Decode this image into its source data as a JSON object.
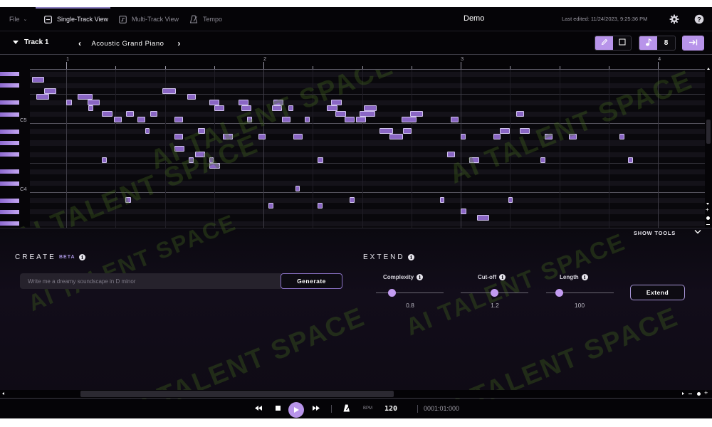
{
  "topnav": {
    "file_menu": "File",
    "tabs": [
      {
        "label": "Single-Track View",
        "active": true
      },
      {
        "label": "Multi-Track View",
        "active": false
      },
      {
        "label": "Tempo",
        "active": false
      }
    ],
    "doc_title": "Demo",
    "last_edited": "Last edited: 11/24/2023, 9:25:36 PM"
  },
  "track": {
    "name": "Track 1",
    "instrument": "Acoustic Grand Piano",
    "draw_tool_active": true,
    "select_tool_active": false,
    "note_length_value": "8"
  },
  "ruler": {
    "bars": [
      "1",
      "2",
      "3",
      "4"
    ]
  },
  "piano_roll": {
    "key_labels": [
      {
        "label": "C5",
        "pitch": 72
      },
      {
        "label": "C4",
        "pitch": 60
      }
    ],
    "top_pitch": 80,
    "beats_per_bar": 4,
    "notes": [
      {
        "pitch": 79,
        "start": -0.7,
        "dur": 0.25
      },
      {
        "pitch": 77,
        "start": -0.45,
        "dur": 0.25
      },
      {
        "pitch": 76,
        "start": -0.6,
        "dur": 0.25
      },
      {
        "pitch": 76,
        "start": 0.23,
        "dur": 0.3
      },
      {
        "pitch": 75,
        "start": 0.0,
        "dur": 0.12
      },
      {
        "pitch": 75,
        "start": 0.43,
        "dur": 0.25
      },
      {
        "pitch": 73,
        "start": 0.72,
        "dur": 0.22
      },
      {
        "pitch": 72,
        "start": 0.97,
        "dur": 0.15
      },
      {
        "pitch": 73,
        "start": 1.22,
        "dur": 0.15
      },
      {
        "pitch": 72,
        "start": 1.45,
        "dur": 0.15
      },
      {
        "pitch": 73,
        "start": 1.7,
        "dur": 0.15
      },
      {
        "pitch": 70,
        "start": 1.6,
        "dur": 0.06
      },
      {
        "pitch": 77,
        "start": 1.95,
        "dur": 0.27
      },
      {
        "pitch": 76,
        "start": 2.45,
        "dur": 0.18
      },
      {
        "pitch": 75,
        "start": 2.9,
        "dur": 0.2
      },
      {
        "pitch": 75,
        "start": 3.5,
        "dur": 0.2
      },
      {
        "pitch": 75,
        "start": 4.2,
        "dur": 0.2
      },
      {
        "pitch": 75,
        "start": 5.37,
        "dur": 0.22
      },
      {
        "pitch": 72,
        "start": 2.2,
        "dur": 0.17
      },
      {
        "pitch": 72,
        "start": 3.67,
        "dur": 0.1
      },
      {
        "pitch": 72,
        "start": 4.38,
        "dur": 0.17
      },
      {
        "pitch": 72,
        "start": 4.84,
        "dur": 0.1
      },
      {
        "pitch": 72,
        "start": 5.65,
        "dur": 0.2
      },
      {
        "pitch": 72,
        "start": 5.88,
        "dur": 0.2
      },
      {
        "pitch": 72,
        "start": 6.8,
        "dur": 0.3
      },
      {
        "pitch": 72,
        "start": 7.8,
        "dur": 0.15
      },
      {
        "pitch": 73,
        "start": 5.46,
        "dur": 0.22
      },
      {
        "pitch": 73,
        "start": 5.95,
        "dur": 0.32
      },
      {
        "pitch": 73,
        "start": 6.97,
        "dur": 0.27
      },
      {
        "pitch": 70,
        "start": 2.67,
        "dur": 0.15
      },
      {
        "pitch": 70,
        "start": 6.36,
        "dur": 0.27
      },
      {
        "pitch": 70,
        "start": 6.83,
        "dur": 0.17
      },
      {
        "pitch": 69,
        "start": 2.2,
        "dur": 0.17
      },
      {
        "pitch": 69,
        "start": 3.18,
        "dur": 0.2
      },
      {
        "pitch": 69,
        "start": 3.9,
        "dur": 0.15
      },
      {
        "pitch": 69,
        "start": 4.6,
        "dur": 0.2
      },
      {
        "pitch": 69,
        "start": 6.56,
        "dur": 0.27
      },
      {
        "pitch": 69,
        "start": 8.0,
        "dur": 0.1
      },
      {
        "pitch": 69,
        "start": 8.66,
        "dur": 0.15
      },
      {
        "pitch": 69,
        "start": 9.7,
        "dur": 0.17
      },
      {
        "pitch": 69,
        "start": 10.2,
        "dur": 0.15
      },
      {
        "pitch": 69,
        "start": 11.22,
        "dur": 0.1
      },
      {
        "pitch": 70,
        "start": 8.8,
        "dur": 0.2
      },
      {
        "pitch": 70,
        "start": 9.2,
        "dur": 0.2
      },
      {
        "pitch": 73,
        "start": 9.12,
        "dur": 0.17
      },
      {
        "pitch": 67,
        "start": 2.2,
        "dur": 0.2
      },
      {
        "pitch": 66,
        "start": 2.62,
        "dur": 0.2
      },
      {
        "pitch": 66,
        "start": 7.72,
        "dur": 0.17
      },
      {
        "pitch": 65,
        "start": 0.72,
        "dur": 0.1
      },
      {
        "pitch": 65,
        "start": 2.48,
        "dur": 0.1
      },
      {
        "pitch": 65,
        "start": 2.9,
        "dur": 0.06
      },
      {
        "pitch": 65,
        "start": 5.1,
        "dur": 0.12
      },
      {
        "pitch": 65,
        "start": 8.17,
        "dur": 0.2
      },
      {
        "pitch": 65,
        "start": 9.62,
        "dur": 0.1
      },
      {
        "pitch": 65,
        "start": 11.4,
        "dur": 0.1
      },
      {
        "pitch": 64,
        "start": 2.9,
        "dur": 0.22
      },
      {
        "pitch": 60,
        "start": 4.65,
        "dur": 0.08
      },
      {
        "pitch": 58,
        "start": 1.2,
        "dur": 0.12
      },
      {
        "pitch": 58,
        "start": 5.75,
        "dur": 0.1
      },
      {
        "pitch": 58,
        "start": 7.58,
        "dur": 0.08
      },
      {
        "pitch": 58,
        "start": 8.97,
        "dur": 0.08
      },
      {
        "pitch": 57,
        "start": 4.1,
        "dur": 0.1
      },
      {
        "pitch": 57,
        "start": 5.1,
        "dur": 0.1
      },
      {
        "pitch": 56,
        "start": 8.0,
        "dur": 0.12
      },
      {
        "pitch": 55,
        "start": 8.33,
        "dur": 0.25
      },
      {
        "pitch": 74,
        "start": 0.45,
        "dur": 0.1
      },
      {
        "pitch": 74,
        "start": 3.0,
        "dur": 0.2
      },
      {
        "pitch": 74,
        "start": 3.55,
        "dur": 0.2
      },
      {
        "pitch": 74,
        "start": 4.17,
        "dur": 0.2
      },
      {
        "pitch": 74,
        "start": 5.28,
        "dur": 0.22
      },
      {
        "pitch": 74,
        "start": 6.03,
        "dur": 0.27
      },
      {
        "pitch": 74,
        "start": 4.5,
        "dur": 0.1
      }
    ]
  },
  "tools_toggle": {
    "label": "SHOW TOOLS"
  },
  "create": {
    "title": "CREATE",
    "badge": "BETA",
    "prompt_placeholder": "Write me a dreamy soundscape in D minor",
    "prompt_value": "",
    "generate_label": "Generate"
  },
  "extend": {
    "title": "EXTEND",
    "sliders": [
      {
        "label": "Complexity",
        "value": "0.8",
        "fraction": 0.24
      },
      {
        "label": "Cut-off",
        "value": "1.2",
        "fraction": 0.5
      },
      {
        "label": "Length",
        "value": "100",
        "fraction": 0.19
      }
    ],
    "extend_label": "Extend"
  },
  "transport": {
    "bpm_label": "BPM",
    "bpm": "120",
    "position": "0001:01:000"
  },
  "colors": {
    "accent": "#b894ea",
    "note_fill": "#8a66c4",
    "background": "#08070b"
  },
  "watermark": "AI TALENT SPACE"
}
